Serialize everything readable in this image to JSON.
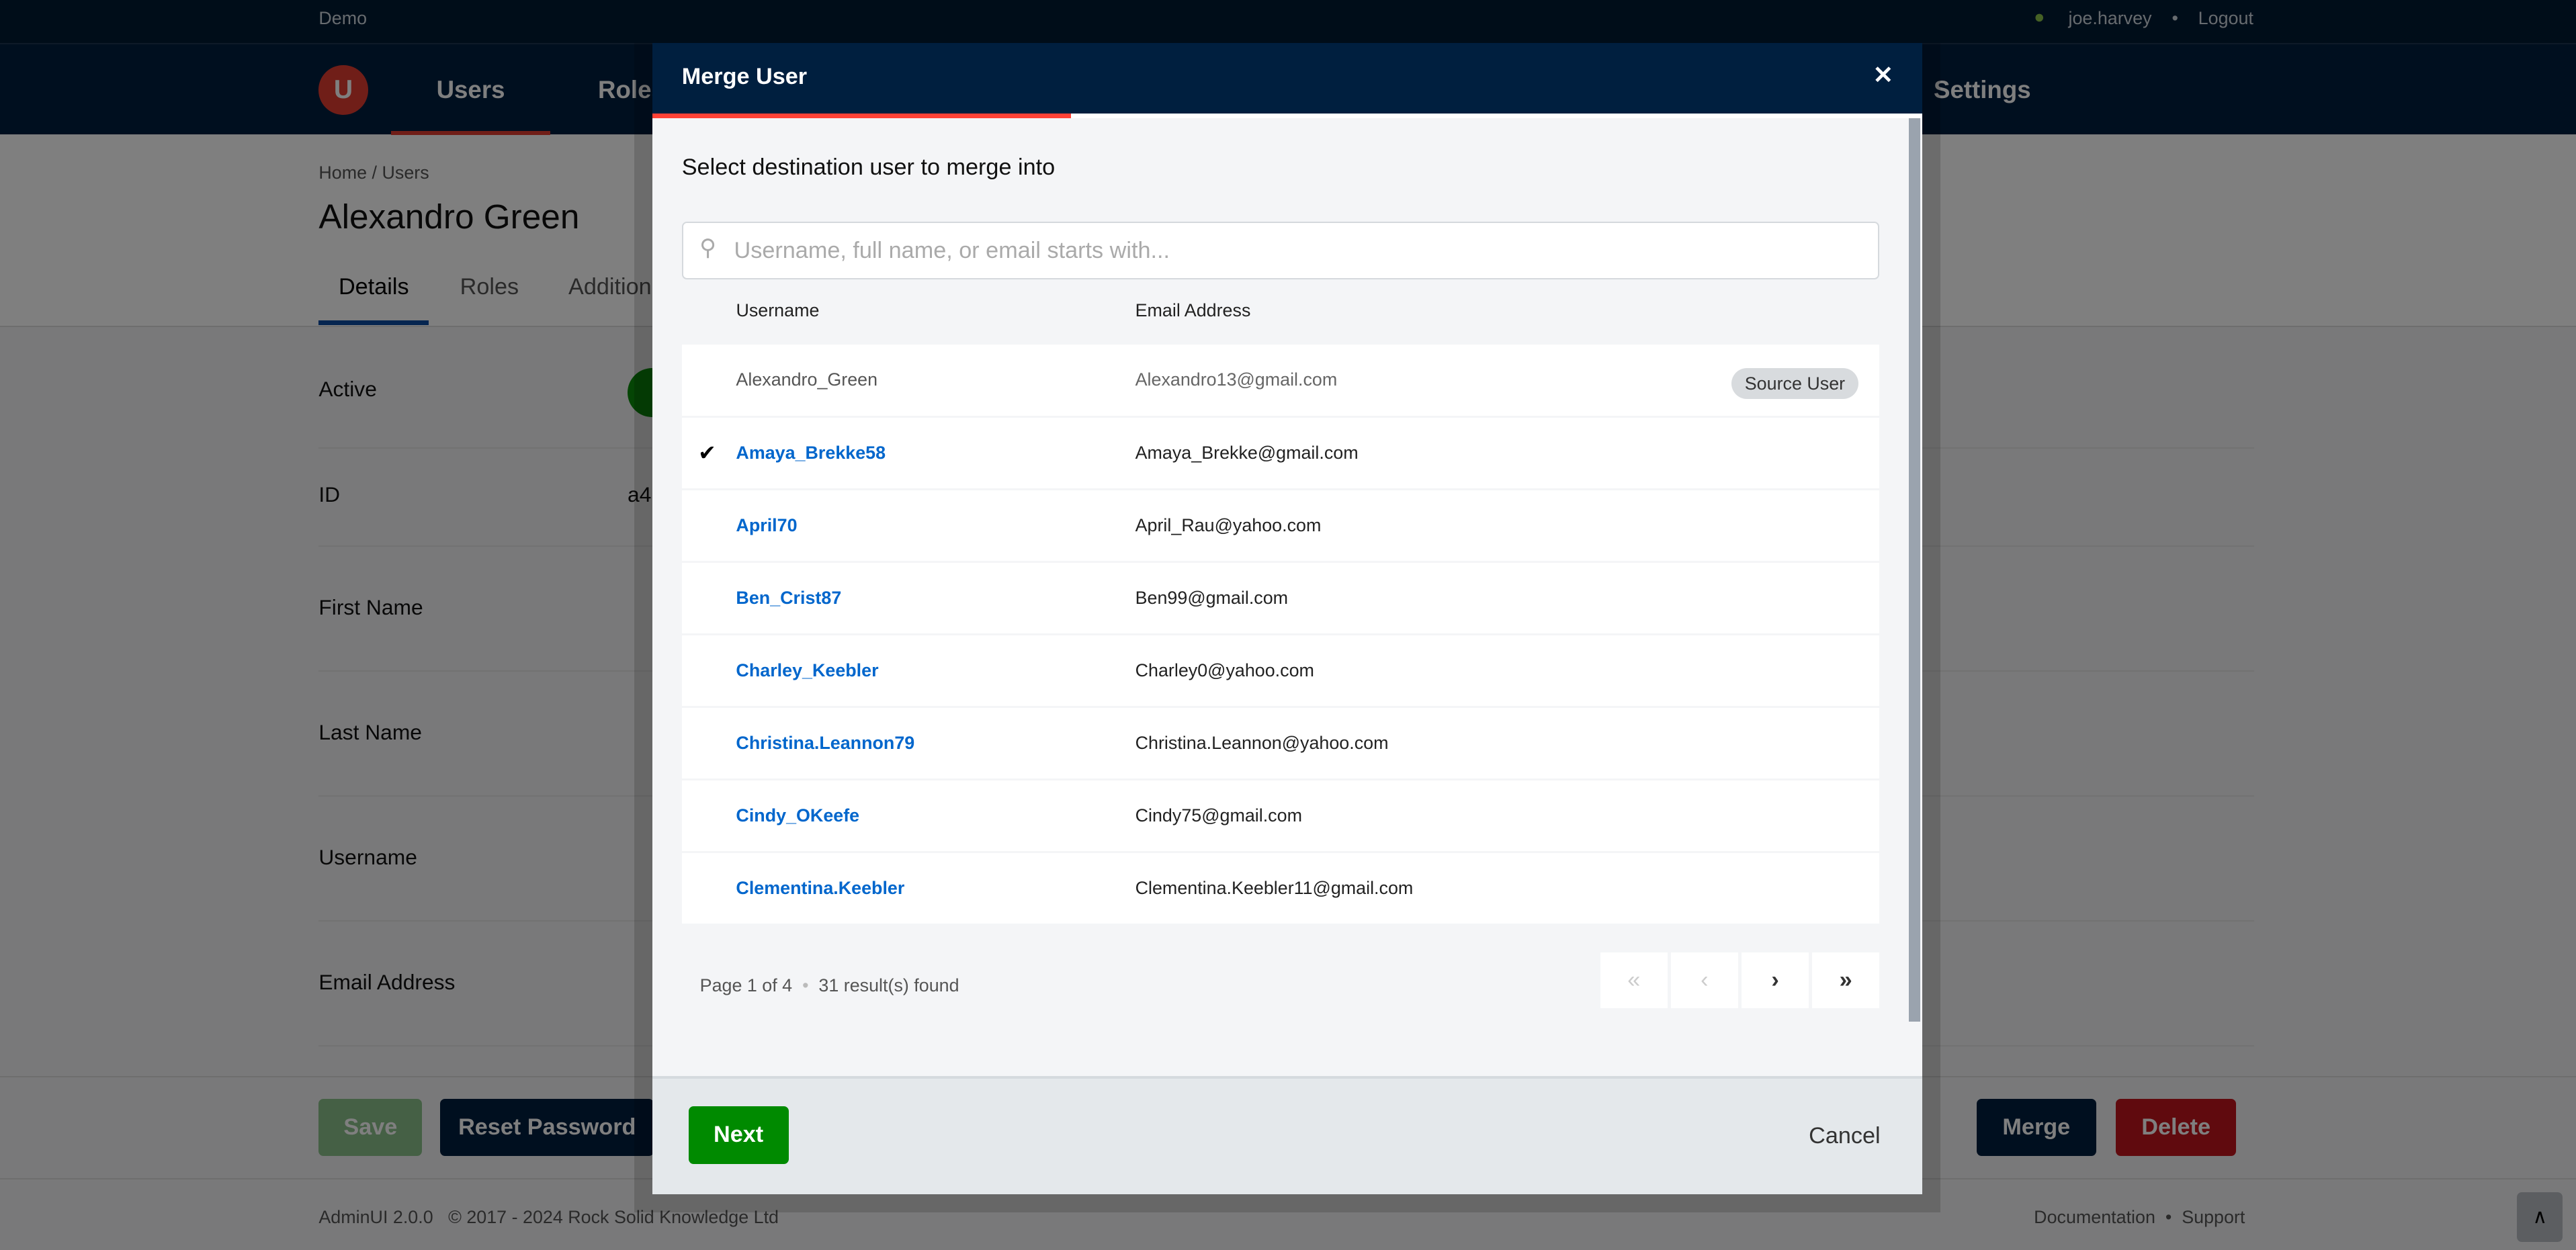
{
  "topbar": {
    "env": "Demo",
    "user": "joe.harvey",
    "logout": "Logout"
  },
  "nav": {
    "logo": "U",
    "items": [
      "Users",
      "Roles",
      "Settings"
    ]
  },
  "page": {
    "breadcrumb": [
      "Home",
      "Users"
    ],
    "title": "Alexandro Green",
    "tabs": [
      "Details",
      "Roles",
      "Addition"
    ],
    "fields": [
      {
        "label": "Active"
      },
      {
        "label": "ID",
        "value": "a4"
      },
      {
        "label": "First Name"
      },
      {
        "label": "Last Name"
      },
      {
        "label": "Username"
      },
      {
        "label": "Email Address"
      }
    ],
    "buttons": {
      "save": "Save",
      "reset": "Reset Password",
      "merge": "Merge",
      "delete": "Delete"
    },
    "footer": {
      "version": "AdminUI 2.0.0",
      "copyright": "© 2017 - 2024 Rock Solid Knowledge Ltd",
      "docs": "Documentation",
      "support": "Support"
    }
  },
  "modal": {
    "title": "Merge User",
    "close": "✕",
    "step_progress": 0.33,
    "subtitle": "Select destination user to merge into",
    "search_placeholder": "Username, full name, or email starts with...",
    "columns": [
      "Username",
      "Email Address"
    ],
    "rows": [
      {
        "username": "Alexandro_Green",
        "email": "Alexandro13@gmail.com",
        "badge": "Source User",
        "source": true
      },
      {
        "username": "Amaya_Brekke58",
        "email": "Amaya_Brekke@gmail.com",
        "selected": true
      },
      {
        "username": "April70",
        "email": "April_Rau@yahoo.com"
      },
      {
        "username": "Ben_Crist87",
        "email": "Ben99@gmail.com"
      },
      {
        "username": "Charley_Keebler",
        "email": "Charley0@yahoo.com"
      },
      {
        "username": "Christina.Leannon79",
        "email": "Christina.Leannon@yahoo.com"
      },
      {
        "username": "Cindy_OKeefe",
        "email": "Cindy75@gmail.com"
      },
      {
        "username": "Clementina.Keebler",
        "email": "Clementina.Keebler11@gmail.com"
      }
    ],
    "pagination": {
      "page": "Page 1 of 4",
      "results": "31 result(s) found",
      "first": "«",
      "prev": "‹",
      "next": "›",
      "last": "»"
    },
    "next": "Next",
    "cancel": "Cancel"
  },
  "colors": {
    "navy": "#001f3f",
    "accent": "#e03c31",
    "link": "#0066cc",
    "green": "#008a00"
  }
}
